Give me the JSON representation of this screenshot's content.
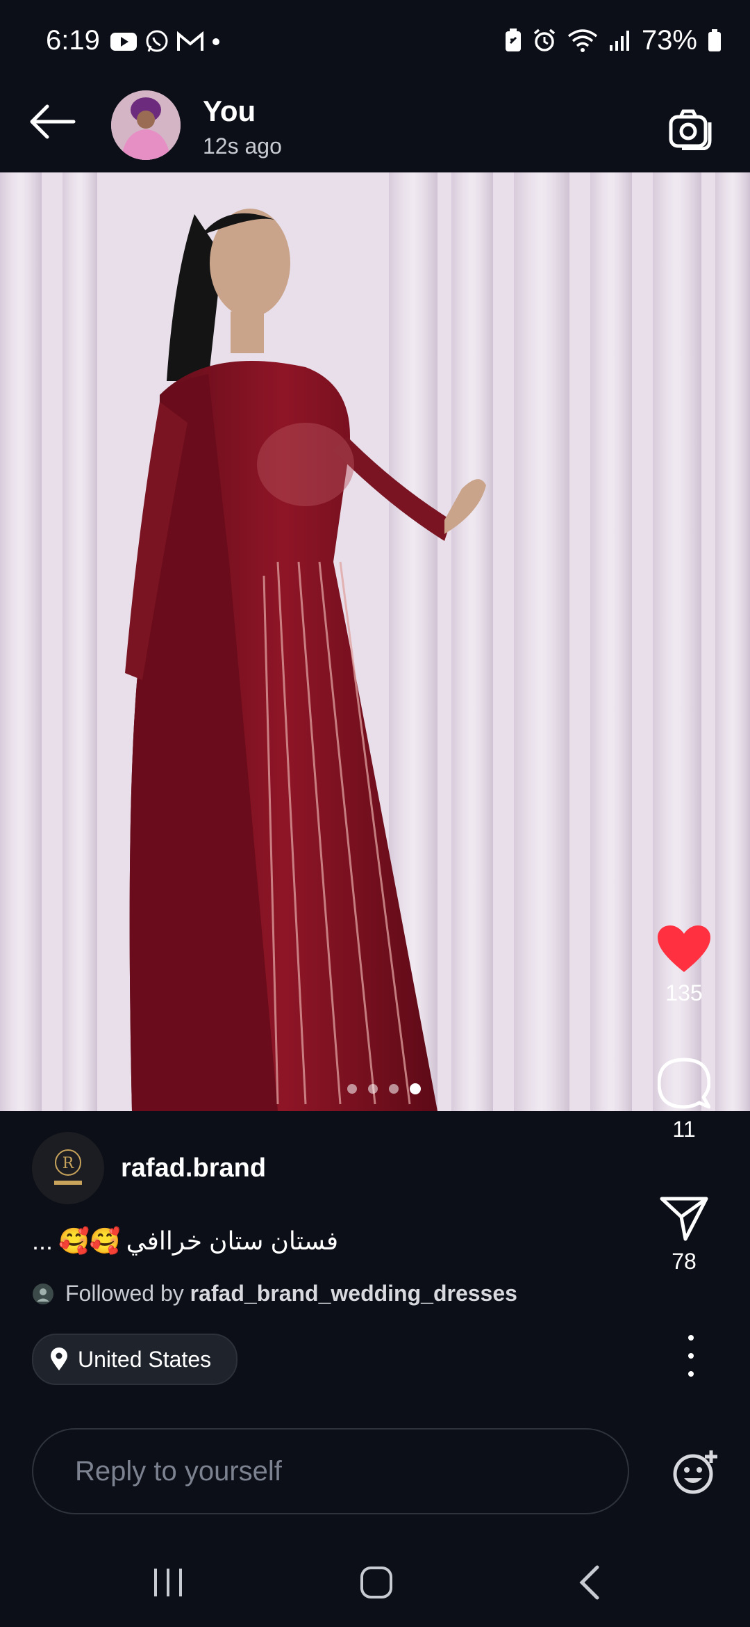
{
  "status_bar": {
    "time": "6:19",
    "battery": "73%",
    "left_icons": [
      "youtube-icon",
      "whatsapp-icon",
      "gmail-icon",
      "dot-icon"
    ],
    "right_icons": [
      "battery-saver-icon",
      "alarm-icon",
      "wifi-icon",
      "signal-icon",
      "battery-icon"
    ]
  },
  "header": {
    "name": "You",
    "time": "12s ago"
  },
  "media": {
    "progress_count": 4,
    "active_index": 3
  },
  "actions": {
    "likes": "135",
    "comments": "11",
    "shares": "78",
    "like_color": "#ff3040"
  },
  "post": {
    "username": "rafad.brand",
    "caption": "فستان ستان خراافي",
    "caption_emojis": "🥰🥰",
    "caption_more": "...",
    "followed_prefix": "Followed by",
    "followed_user": "rafad_brand_wedding_dresses",
    "location": "United States"
  },
  "reply": {
    "placeholder": "Reply to yourself"
  }
}
